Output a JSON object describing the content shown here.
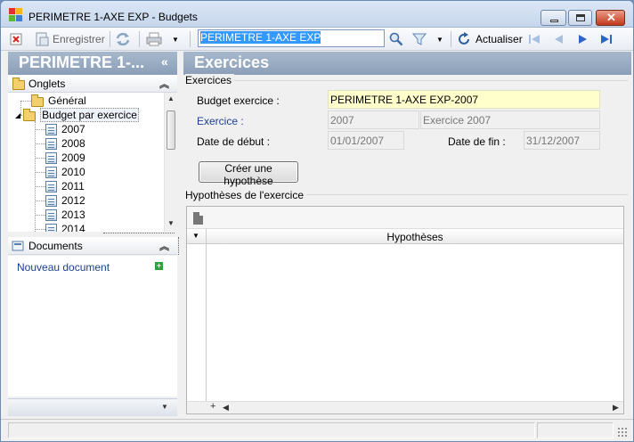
{
  "window": {
    "title": "PERIMETRE 1-AXE EXP -  Budgets"
  },
  "toolbar": {
    "save_label": "Enregistrer",
    "search_value": "PERIMETRE 1-AXE EXP",
    "refresh_label": "Actualiser"
  },
  "left": {
    "header": "PERIMETRE 1-...",
    "collapse_glyph": "«",
    "tabs_section": "Onglets",
    "tree": [
      {
        "label": "Général",
        "kind": "folder"
      },
      {
        "label": "Budget par exercice",
        "kind": "folder-open"
      },
      {
        "label": "2007",
        "kind": "doc"
      },
      {
        "label": "2008",
        "kind": "doc"
      },
      {
        "label": "2009",
        "kind": "doc"
      },
      {
        "label": "2010",
        "kind": "doc"
      },
      {
        "label": "2011",
        "kind": "doc"
      },
      {
        "label": "2012",
        "kind": "doc"
      },
      {
        "label": "2013",
        "kind": "doc"
      },
      {
        "label": "2014",
        "kind": "doc"
      }
    ],
    "documents_section": "Documents",
    "new_document": "Nouveau document"
  },
  "main": {
    "header": "Exercices",
    "group_exercices": "Exercices",
    "budget_label": "Budget exercice :",
    "budget_value": "PERIMETRE 1-AXE EXP-2007",
    "exercice_label": "Exercice :",
    "exercice_code": "2007",
    "exercice_name": "Exercice 2007",
    "start_label": "Date de début :",
    "start_value": "01/01/2007",
    "end_label": "Date de fin :",
    "end_value": "31/12/2007",
    "create_button": "Créer une hypothèse",
    "group_hypotheses": "Hypothèses de l'exercice",
    "grid_column": "Hypothèses"
  }
}
